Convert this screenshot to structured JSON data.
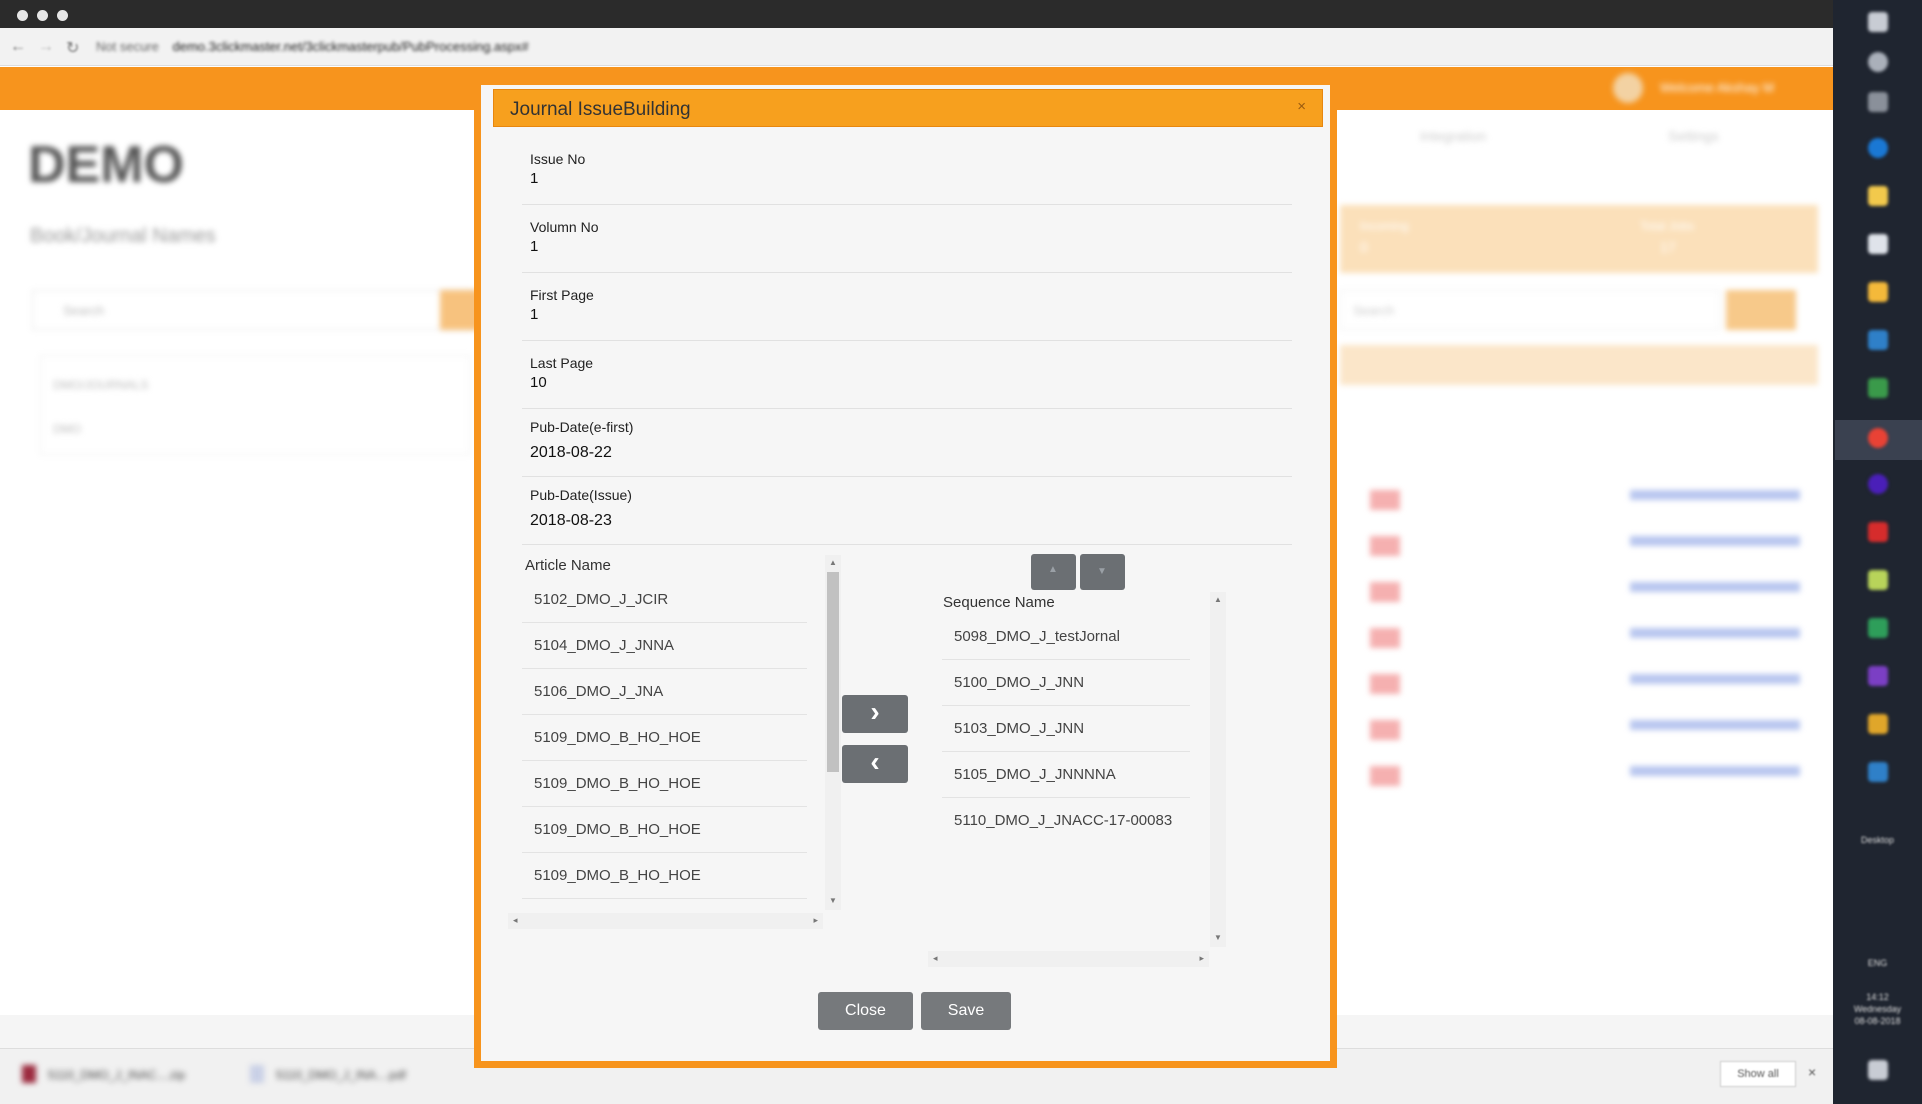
{
  "background": {
    "address": "demo.3clickmaster.net/3clickmasterpub/PubProcessing.aspx#",
    "security": "Not secure",
    "welcome": "Welcome Akshay M",
    "brand": "DEMO",
    "left_title": "Book/Journal Names",
    "search_placeholder": "Search",
    "right_search_placeholder": "Search",
    "list_items": [
      "DMO/JOURNALS",
      "DMO"
    ],
    "nav": [
      "Integration",
      "Settings"
    ],
    "counters": [
      {
        "label": "Incoming",
        "value": "0"
      },
      {
        "label": "Total Jobs",
        "value": "17"
      }
    ],
    "download_files": [
      "5110_DMO_J_INAC....zip",
      "5110_DMO_J_INA....pdf"
    ],
    "show_all": "Show all",
    "desktop_label": "Desktop",
    "clock": {
      "time": "14:12",
      "day": "Wednesday",
      "date": "08-08-2018"
    },
    "lang": "ENG"
  },
  "modal": {
    "title": "Journal IssueBuilding",
    "close_icon": "×",
    "fields": [
      {
        "label": "Issue No",
        "value": "1"
      },
      {
        "label": "Volumn No",
        "value": "1"
      },
      {
        "label": "First Page",
        "value": "1"
      },
      {
        "label": "Last Page",
        "value": "10"
      },
      {
        "label": "Pub-Date(e-first)",
        "value": "2018-08-22"
      },
      {
        "label": "Pub-Date(Issue)",
        "value": "2018-08-23"
      }
    ],
    "article_header": "Article Name",
    "articles": [
      "5102_DMO_J_JCIR",
      "5104_DMO_J_JNNA",
      "5106_DMO_J_JNA",
      "5109_DMO_B_HO_HOE",
      "5109_DMO_B_HO_HOE",
      "5109_DMO_B_HO_HOE",
      "5109_DMO_B_HO_HOE"
    ],
    "sequence_header": "Sequence Name",
    "sequences": [
      "5098_DMO_J_testJornal",
      "5100_DMO_J_JNN",
      "5103_DMO_J_JNN",
      "5105_DMO_J_JNNNNA",
      "5110_DMO_J_JNACC-17-00083"
    ],
    "move_right": "›",
    "move_left": "‹",
    "close_label": "Close",
    "save_label": "Save"
  }
}
